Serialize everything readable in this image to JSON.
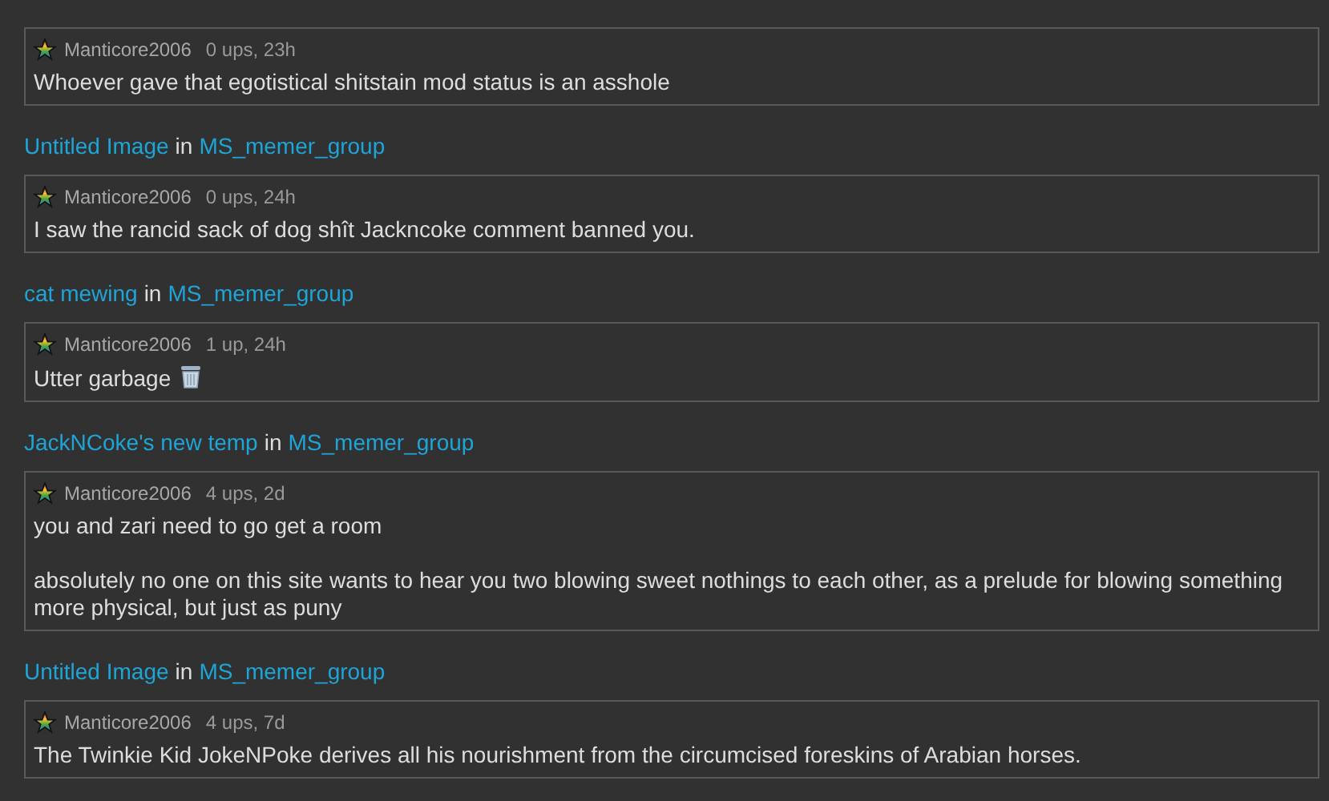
{
  "comments": [
    {
      "user": "Manticore2006",
      "meta": "0 ups, 23h",
      "paragraphs": [
        "Whoever gave that egotistical shitstain mod status is an asshole"
      ]
    },
    {
      "post": "Untitled Image",
      "in": "in",
      "group": "MS_memer_group",
      "user": "Manticore2006",
      "meta": "0 ups, 24h",
      "paragraphs": [
        "I saw the rancid sack of dog shît Jackncoke comment banned you."
      ]
    },
    {
      "post": "cat mewing",
      "in": "in",
      "group": "MS_memer_group",
      "user": "Manticore2006",
      "meta": "1 up, 24h",
      "paragraphs": [
        "Utter garbage"
      ],
      "trailing_emoji": true
    },
    {
      "post": "JackNCoke's new temp",
      "in": "in",
      "group": "MS_memer_group",
      "user": "Manticore2006",
      "meta": "4 ups, 2d",
      "paragraphs": [
        "you and zari need to go get a room",
        "absolutely no one on this site wants to hear you two blowing sweet nothings to each other, as a prelude for blowing something more physical, but just as puny"
      ]
    },
    {
      "post": "Untitled Image",
      "in": "in",
      "group": "MS_memer_group",
      "user": "Manticore2006",
      "meta": "4 ups, 7d",
      "paragraphs": [
        "The Twinkie Kid JokeNPoke derives all his nourishment from the circumcised foreskins of Arabian horses."
      ]
    }
  ]
}
